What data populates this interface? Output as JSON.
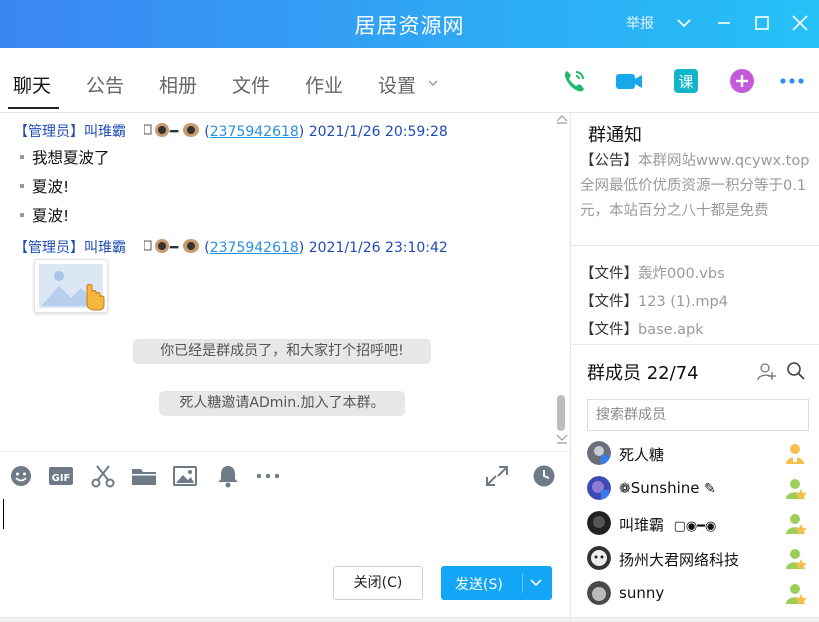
{
  "window": {
    "title": "居居资源网",
    "report_label": "举报"
  },
  "tabs": [
    {
      "label": "聊天",
      "active": true
    },
    {
      "label": "公告"
    },
    {
      "label": "相册"
    },
    {
      "label": "文件"
    },
    {
      "label": "作业"
    },
    {
      "label": "设置"
    }
  ],
  "actions": [
    "phone-icon",
    "video-icon",
    "class-icon",
    "add-app-icon",
    "more-icon"
  ],
  "chat": {
    "messages": [
      {
        "role_tag": "【管理员】",
        "sender": "叫琟霸",
        "qq": "2375942618",
        "time": "2021/1/26 20:59:28",
        "lines": [
          "我想夏波了",
          "夏波!",
          "夏波!"
        ]
      },
      {
        "role_tag": "【管理员】",
        "sender": "叫琟霸",
        "qq": "2375942618",
        "time": "2021/1/26 23:10:42",
        "image": "image-placeholder-icon"
      }
    ],
    "system_notices": [
      "你已经是群成员了，和大家打个招呼吧!",
      "死人糖邀请ADmin.加入了本群。"
    ]
  },
  "toolbar": [
    "emoji-icon",
    "gif-icon",
    "scissors-icon",
    "folder-icon",
    "picture-icon",
    "bell-icon",
    "more-icon",
    "expand-icon",
    "history-icon"
  ],
  "input": {
    "close_label": "关闭(C)",
    "send_label": "发送(S)"
  },
  "side": {
    "notice_title": "群通知",
    "notice_key": "【公告】",
    "notice_text": "本群网站www.qcywx.top全网最低价优质资源一积分等于0.1元，本站百分之八十都是免费",
    "files": [
      {
        "key": "【文件】",
        "name": "轰炸000.vbs"
      },
      {
        "key": "【文件】",
        "name": "123 (1).mp4"
      },
      {
        "key": "【文件】",
        "name": "base.apk"
      }
    ],
    "members_title": "群成员 22/74",
    "search_placeholder": "搜索群成员",
    "members": [
      {
        "name": "死人糖",
        "role": "owner"
      },
      {
        "name": "Sunshine",
        "role": "admin"
      },
      {
        "name": "叫琟霸",
        "role": "admin"
      },
      {
        "name": "扬州大君网络科技",
        "role": "admin"
      },
      {
        "name": "sunny",
        "role": "admin"
      }
    ]
  },
  "colors": {
    "titlebar_start": "#3b86f2",
    "titlebar_end": "#25c1f7",
    "send_button": "#13a5f6",
    "admin_tag": "#1e4db5",
    "qq_link": "#2a8fe0"
  }
}
